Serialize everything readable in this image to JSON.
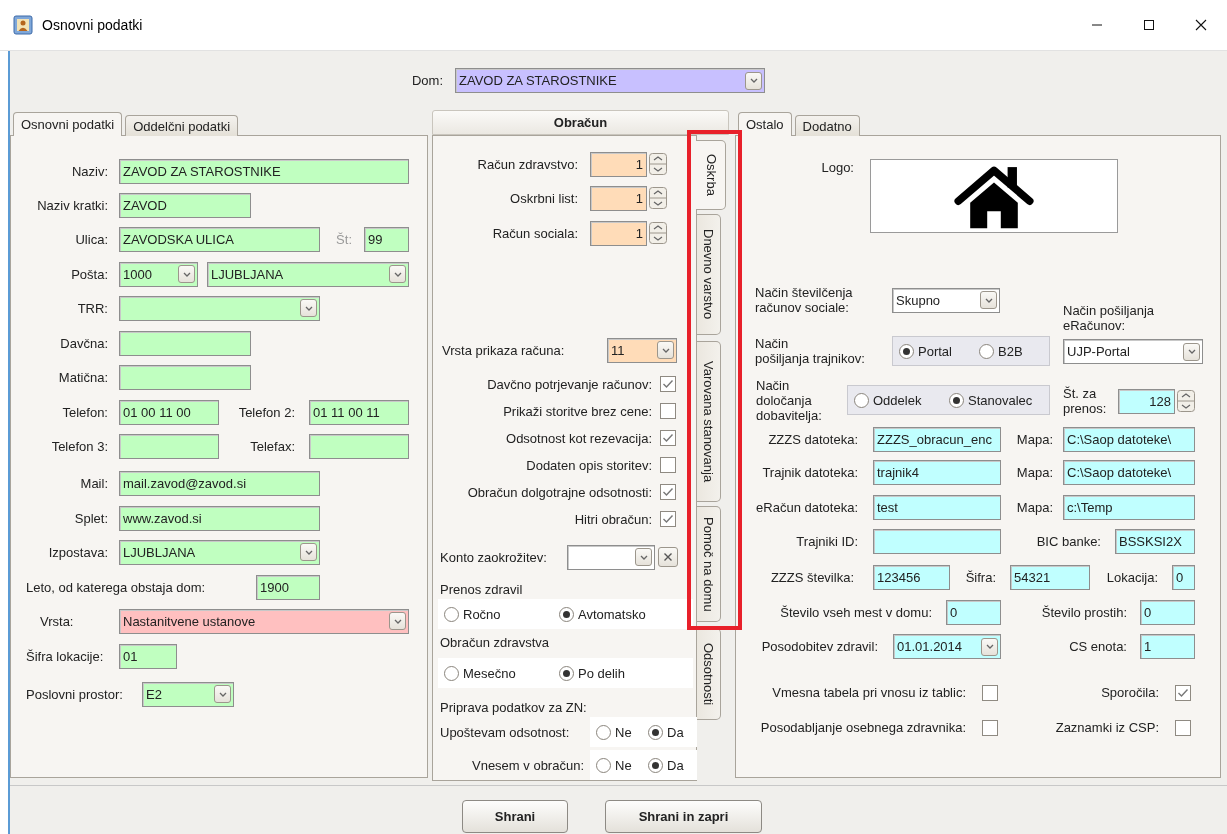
{
  "window": {
    "title": "Osnovni podatki"
  },
  "dom": {
    "label": "Dom:",
    "value": "ZAVOD ZA STAROSTNIKE",
    "color": "#c8c0ff"
  },
  "left_panel": {
    "tabs": [
      {
        "label": "Osnovni podatki",
        "selected": true
      },
      {
        "label": "Oddelčni podatki",
        "selected": false
      }
    ],
    "rows": [
      {
        "items": [
          {
            "kind": "label",
            "text": "Naziv:"
          },
          {
            "kind": "field",
            "value": "ZAVOD ZA STAROSTNIKE",
            "color": "#c0ffc0"
          }
        ]
      },
      {
        "items": [
          {
            "kind": "label",
            "text": "Naziv kratki:"
          },
          {
            "kind": "field",
            "value": "ZAVOD",
            "color": "#c0ffc0"
          }
        ]
      },
      {
        "items": [
          {
            "kind": "label",
            "text": "Ulica:",
            "disabled": false
          },
          {
            "kind": "field",
            "value": "ZAVODSKA ULICA",
            "color": "#c0ffc0"
          }
        ],
        "number": [
          {
            "kind": "label",
            "text": "Št:",
            "disabled": true
          },
          {
            "kind": "field",
            "value": "99",
            "color": "#c0ffc0"
          }
        ]
      },
      {
        "items": [
          {
            "kind": "label",
            "text": "Pošta:"
          },
          {
            "kind": "combo",
            "value": "1000",
            "color": "#c0ffc0"
          },
          {
            "kind": "combo",
            "value": "LJUBLJANA",
            "color": "#c0ffc0"
          }
        ]
      },
      {
        "items": [
          {
            "kind": "label",
            "text": "TRR:"
          },
          {
            "kind": "combo",
            "color": "#c0ffc0"
          }
        ]
      },
      {
        "items": [
          {
            "kind": "label",
            "text": "Davčna:"
          },
          {
            "kind": "field",
            "color": "#c0ffc0"
          }
        ]
      },
      {
        "items": [
          {
            "kind": "label",
            "text": "Matična:"
          },
          {
            "kind": "field",
            "color": "#c0ffc0"
          }
        ]
      },
      {
        "items": [
          {
            "kind": "label",
            "text": "Telefon:"
          },
          {
            "kind": "field",
            "value": "01 00 11 00",
            "color": "#c0ffc0"
          },
          {
            "kind": "label",
            "text": "Telefon 2:"
          },
          {
            "kind": "field",
            "value": "01 11 00 11",
            "color": "#c0ffc0"
          }
        ]
      },
      {
        "items": [
          {
            "kind": "label",
            "text": "Telefon 3:"
          },
          {
            "kind": "field",
            "color": "#c0ffc0"
          },
          {
            "kind": "label",
            "text": "Telefax:"
          },
          {
            "kind": "field",
            "color": "#c0ffc0"
          }
        ]
      },
      {
        "items": [
          {
            "kind": "label",
            "text": "Mail:"
          },
          {
            "kind": "field",
            "value": "mail.zavod@zavod.si",
            "color": "#c0ffc0"
          }
        ]
      },
      {
        "items": [
          {
            "kind": "label",
            "text": "Splet:"
          },
          {
            "kind": "field",
            "value": "www.zavod.si",
            "color": "#c0ffc0"
          }
        ]
      },
      {
        "items": [
          {
            "kind": "label",
            "text": "Izpostava:"
          },
          {
            "kind": "combo",
            "value": "LJUBLJANA",
            "color": "#c0ffc0"
          }
        ]
      },
      {
        "items": [
          {
            "kind": "label",
            "text": "Leto, od katerega obstaja dom:"
          },
          {
            "kind": "field",
            "value": "1900",
            "color": "#c0ffc0"
          }
        ]
      },
      {
        "items": [
          {
            "kind": "label",
            "text": "Vrsta:"
          },
          {
            "kind": "combo",
            "value": "Nastanitvene ustanove",
            "color": "#ffc0c0"
          }
        ]
      },
      {
        "items": [
          {
            "kind": "label",
            "text": "Šifra lokacije:"
          },
          {
            "kind": "field",
            "value": "01",
            "color": "#c0ffc0"
          }
        ]
      },
      {
        "items": [
          {
            "kind": "label",
            "text": "Poslovni prostor:"
          },
          {
            "kind": "combo",
            "value": "E2",
            "color": "#c0ffc0"
          }
        ]
      }
    ]
  },
  "middle_panel": {
    "title": "Obračun",
    "rows": [
      [
        {
          "kind": "label",
          "text": "Račun zdravstvo:"
        },
        {
          "kind": "spin",
          "value": "1",
          "color": "#ffdcb8"
        }
      ],
      [
        {
          "kind": "label",
          "text": "Oskrbni list:"
        },
        {
          "kind": "spin",
          "value": "1",
          "color": "#ffdcb8"
        }
      ],
      [
        {
          "kind": "label",
          "text": "Račun sociala:"
        },
        {
          "kind": "spin",
          "value": "1",
          "color": "#ffdcb8"
        }
      ],
      [
        {
          "kind": "label",
          "text": "Vrsta prikaza računa:"
        },
        {
          "kind": "combo",
          "value": "11",
          "color": "#ffdcb8"
        }
      ],
      [
        {
          "kind": "label",
          "text": "Davčno potrjevanje računov:"
        },
        {
          "kind": "check",
          "checked": true
        }
      ],
      [
        {
          "kind": "label",
          "text": "Prikaži storitve brez cene:"
        },
        {
          "kind": "check",
          "checked": false
        }
      ],
      [
        {
          "kind": "label",
          "text": "Odsotnost kot rezevacija:"
        },
        {
          "kind": "check",
          "checked": true
        }
      ],
      [
        {
          "kind": "label",
          "text": "Dodaten opis storitev:"
        },
        {
          "kind": "check",
          "checked": false
        }
      ],
      [
        {
          "kind": "label",
          "text": "Obračun dolgotrajne odsotnosti:"
        },
        {
          "kind": "check",
          "checked": true
        }
      ],
      [
        {
          "kind": "label",
          "text": "Hitri obračun:"
        },
        {
          "kind": "check",
          "checked": true
        }
      ],
      [
        {
          "kind": "label",
          "text": "Konto zaokrožitev:"
        },
        {
          "kind": "combo",
          "color": "#ffffff"
        },
        {
          "kind": "clear"
        }
      ],
      [
        {
          "kind": "heading",
          "text": "Prenos zdravil"
        }
      ],
      [
        {
          "kind": "radios",
          "color": "#ffffff",
          "options": [
            {
              "label": "Ročno",
              "selected": false
            },
            {
              "label": "Avtomatsko",
              "selected": true
            }
          ]
        }
      ],
      [
        {
          "kind": "heading",
          "text": "Obračun zdravstva"
        }
      ],
      [
        {
          "kind": "radios",
          "color": "#ffffff",
          "options": [
            {
              "label": "Mesečno",
              "selected": false
            },
            {
              "label": "Po delih",
              "selected": true
            }
          ]
        }
      ],
      [
        {
          "kind": "heading",
          "text": "Priprava podatkov za ZN:"
        }
      ],
      [
        {
          "kind": "label",
          "text": "Upoštevam odsotnost:"
        },
        {
          "kind": "radios",
          "color": "#ffffff",
          "options": [
            {
              "label": "Ne",
              "selected": false
            },
            {
              "label": "Da",
              "selected": true
            }
          ]
        }
      ],
      [
        {
          "kind": "label",
          "text": "Vnesem v obračun:"
        },
        {
          "kind": "radios",
          "color": "#ffffff",
          "options": [
            {
              "label": "Ne",
              "selected": false
            },
            {
              "label": "Da",
              "selected": true
            }
          ]
        }
      ]
    ],
    "side_tabs": [
      {
        "label": "Oskrba",
        "selected": true
      },
      {
        "label": "Dnevno varstvo",
        "selected": false
      },
      {
        "label": "Varovana stanovanja",
        "selected": false
      },
      {
        "label": "Pomoč na domu",
        "selected": false
      },
      {
        "label": "Odsotnosti",
        "selected": false
      }
    ]
  },
  "right_panel": {
    "tabs": [
      {
        "label": "Ostalo",
        "selected": true
      },
      {
        "label": "Dodatno",
        "selected": false
      }
    ],
    "logo_rows": [
      [
        {
          "kind": "label",
          "text": "Logo:"
        },
        {
          "kind": "logo"
        }
      ]
    ],
    "options": {
      "left_rows": [
        [
          {
            "kind": "label",
            "text": "Način številčenja\nračunov sociale:"
          },
          {
            "kind": "combo",
            "value": "Skupno",
            "color": "#ffffff"
          }
        ],
        [
          {
            "kind": "label",
            "text": "Način\npošiljanja trajnikov:"
          },
          {
            "kind": "radios",
            "color": "#e9e9ef",
            "options": [
              {
                "label": "Portal",
                "selected": true
              },
              {
                "label": "B2B",
                "selected": false
              }
            ]
          }
        ],
        [
          {
            "kind": "label",
            "text": "Način\ndoločanja\ndobavitelja:"
          },
          {
            "kind": "radios",
            "color": "#e9e9ef",
            "options": [
              {
                "label": "Oddelek",
                "selected": false
              },
              {
                "label": "Stanovalec",
                "selected": true
              }
            ]
          }
        ]
      ],
      "right_rows": [
        [
          {
            "kind": "label",
            "text": "Način pošiljanja\neRačunov:"
          }
        ],
        [
          {
            "kind": "combo",
            "value": "UJP-Portal",
            "color": "#ffffff"
          }
        ],
        [
          {
            "kind": "label",
            "text": "Št. za\nprenos:"
          },
          {
            "kind": "spin",
            "value": "128",
            "color": "#c0ffff"
          }
        ]
      ]
    },
    "rows": [
      [
        {
          "kind": "label",
          "text": "ZZZS datoteka:"
        },
        {
          "kind": "field",
          "value": "ZZZS_obracun_enc",
          "color": "#c0ffff"
        },
        {
          "kind": "label",
          "text": "Mapa:"
        },
        {
          "kind": "field",
          "value": "C:\\Saop datoteke\\",
          "color": "#c0ffff"
        }
      ],
      [
        {
          "kind": "label",
          "text": "Trajnik datoteka:"
        },
        {
          "kind": "field",
          "value": "trajnik4",
          "color": "#c0ffff"
        },
        {
          "kind": "label",
          "text": "Mapa:"
        },
        {
          "kind": "field",
          "value": "C:\\Saop datoteke\\",
          "color": "#c0ffff"
        }
      ],
      [
        {
          "kind": "label",
          "text": "eRačun datoteka:"
        },
        {
          "kind": "field",
          "value": "test",
          "color": "#c0ffff"
        },
        {
          "kind": "label",
          "text": "Mapa:"
        },
        {
          "kind": "field",
          "value": "c:\\Temp",
          "color": "#c0ffff"
        }
      ],
      [
        {
          "kind": "label",
          "text": "Trajniki ID:"
        },
        {
          "kind": "field",
          "color": "#c0ffff"
        },
        {
          "kind": "label",
          "text": "BIC banke:"
        },
        {
          "kind": "field",
          "value": "BSSKSI2X",
          "color": "#c0ffff"
        }
      ],
      [
        {
          "kind": "label",
          "text": "ZZZS številka:"
        },
        {
          "kind": "field",
          "value": "123456",
          "color": "#c0ffff"
        },
        {
          "kind": "label",
          "text": "Šifra:"
        },
        {
          "kind": "field",
          "value": "54321",
          "color": "#c0ffff"
        },
        {
          "kind": "label",
          "text": "Lokacija:"
        },
        {
          "kind": "field",
          "value": "0",
          "color": "#c0ffff"
        }
      ],
      [
        {
          "kind": "label",
          "text": "Število vseh mest v domu:"
        },
        {
          "kind": "field",
          "value": "0",
          "color": "#c0ffff"
        },
        {
          "kind": "label",
          "text": "Število prostih:"
        },
        {
          "kind": "field",
          "value": "0",
          "color": "#c0ffff"
        }
      ],
      [
        {
          "kind": "label",
          "text": "Posodobitev zdravil:"
        },
        {
          "kind": "combo",
          "value": "01.01.2014",
          "color": "#c0ffff"
        },
        {
          "kind": "label",
          "text": "CS enota:"
        },
        {
          "kind": "field",
          "value": "1",
          "color": "#c0ffff"
        }
      ],
      [
        {
          "kind": "label",
          "text": "Vmesna tabela pri vnosu iz tablic:"
        },
        {
          "kind": "check",
          "checked": false
        },
        {
          "kind": "label",
          "text": "Sporočila:"
        },
        {
          "kind": "check",
          "checked": true
        }
      ],
      [
        {
          "kind": "label",
          "text": "Posodabljanje osebnega zdravnika:"
        },
        {
          "kind": "check",
          "checked": false
        },
        {
          "kind": "label",
          "text": "Zaznamki iz CSP:"
        },
        {
          "kind": "check",
          "checked": false
        }
      ]
    ]
  },
  "buttons": [
    {
      "label": "Shrani"
    },
    {
      "label": "Shrani in zapri"
    }
  ]
}
